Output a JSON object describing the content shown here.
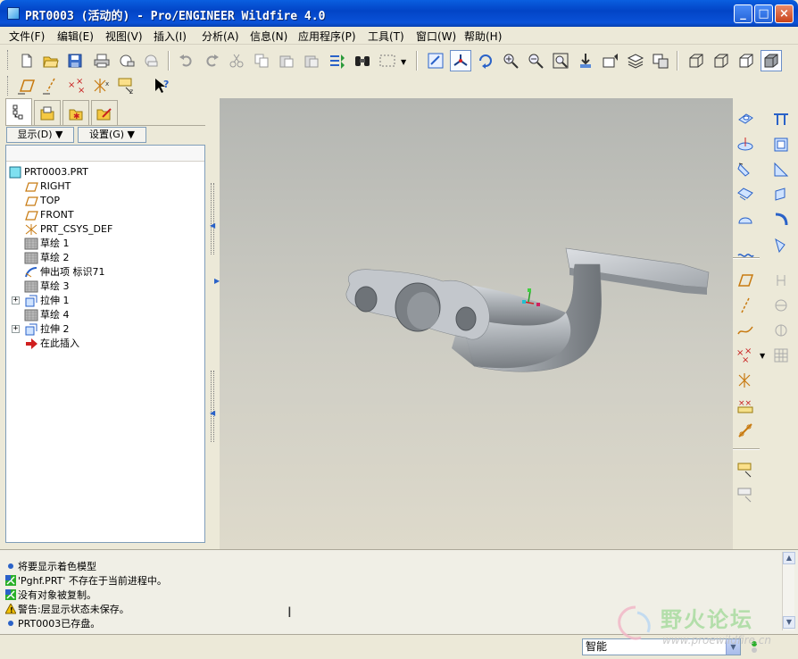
{
  "window": {
    "title": "PRT0003 (活动的) - Pro/ENGINEER Wildfire 4.0",
    "minimize": "_",
    "maximize": "□",
    "close": "×"
  },
  "menu": [
    "文件(F)",
    "编辑(E)",
    "视图(V)",
    "插入(I)",
    "分析(A)",
    "信息(N)",
    "应用程序(P)",
    "工具(T)",
    "窗口(W)",
    "帮助(H)"
  ],
  "toolbar": {
    "row1_icons": [
      "new-icon",
      "open-icon",
      "save-icon",
      "print-icon",
      "email-icon",
      "email-link-icon",
      "undo-icon",
      "redo-icon",
      "cut-icon",
      "copy-icon",
      "paste-icon",
      "paste-special-icon",
      "regenerate-icon",
      "find-icon",
      "select-box-icon",
      "repaint-icon",
      "spin-center-icon",
      "orient-icon",
      "zoom-in-icon",
      "zoom-out-icon",
      "refit-icon",
      "reorient-icon",
      "saved-views-icon",
      "layers-icon",
      "view-manager-icon",
      "wireframe-icon",
      "hidden-line-icon",
      "no-hidden-icon",
      "shading-icon"
    ],
    "row2_icons": [
      "datum-plane-display-icon",
      "datum-axis-display-icon",
      "datum-point-display-icon",
      "csys-display-icon",
      "annotation-display-icon",
      "whats-this-icon"
    ]
  },
  "panel": {
    "tabs": [
      "model-tree-tab",
      "folder-browser-tab",
      "favorites-tab",
      "connections-tab"
    ],
    "show_button": "显示(D) ▼",
    "settings_button": "设置(G) ▼",
    "tree": [
      {
        "label": "PRT0003.PRT",
        "icon": "part-icon",
        "indent": 0,
        "expandable": false
      },
      {
        "label": "RIGHT",
        "icon": "datum-plane-icon",
        "indent": 1,
        "expandable": false
      },
      {
        "label": "TOP",
        "icon": "datum-plane-icon",
        "indent": 1,
        "expandable": false
      },
      {
        "label": "FRONT",
        "icon": "datum-plane-icon",
        "indent": 1,
        "expandable": false
      },
      {
        "label": "PRT_CSYS_DEF",
        "icon": "csys-icon",
        "indent": 1,
        "expandable": false
      },
      {
        "label": "草绘 1",
        "icon": "sketch-icon",
        "indent": 1,
        "expandable": false
      },
      {
        "label": "草绘 2",
        "icon": "sketch-icon",
        "indent": 1,
        "expandable": false
      },
      {
        "label": "伸出项 标识71",
        "icon": "sweep-icon",
        "indent": 1,
        "expandable": false
      },
      {
        "label": "草绘 3",
        "icon": "sketch-icon",
        "indent": 1,
        "expandable": false
      },
      {
        "label": "拉伸 1",
        "icon": "extrude-icon",
        "indent": 1,
        "expandable": true
      },
      {
        "label": "草绘 4",
        "icon": "sketch-icon",
        "indent": 1,
        "expandable": false
      },
      {
        "label": "拉伸 2",
        "icon": "extrude-icon",
        "indent": 1,
        "expandable": true
      },
      {
        "label": "在此插入",
        "icon": "insert-arrow-icon",
        "indent": 1,
        "expandable": false
      }
    ]
  },
  "right_toolbar_icons": [
    "hole-icon",
    "round-icon",
    "shell-icon",
    "rib-icon",
    "draft-icon",
    "chamfer-icon",
    "pattern-icon",
    "mirror-icon",
    "merge-icon",
    "trim-icon",
    "wrap-icon",
    "offset-icon",
    "datum-plane-icon",
    "datum-axis-icon",
    "datum-curve-icon",
    "datum-point-icon",
    "csys-icon",
    "analysis-icon",
    "sketch-tool-icon",
    "extrude-tool-icon",
    "revolve-tool-icon",
    "sweep-tool-icon"
  ],
  "messages": [
    {
      "icon": "info-dot-icon",
      "text": "将要显示着色模型"
    },
    {
      "icon": "find-message-icon",
      "text": "'Pghf.PRT' 不存在于当前进程中。"
    },
    {
      "icon": "find-message-icon",
      "text": "没有对象被复制。"
    },
    {
      "icon": "warning-icon",
      "text": "警告:层显示状态未保存。"
    },
    {
      "icon": "info-dot-icon",
      "text": "PRT0003已存盘。"
    }
  ],
  "status": {
    "filter_value": "智能"
  },
  "watermark": {
    "text": "野火论坛",
    "url": "www.proewildfire.cn"
  },
  "colors": {
    "title_blue": "#0a52d8",
    "part_gray": "#9ea3a8",
    "warning": "#f0c000"
  }
}
